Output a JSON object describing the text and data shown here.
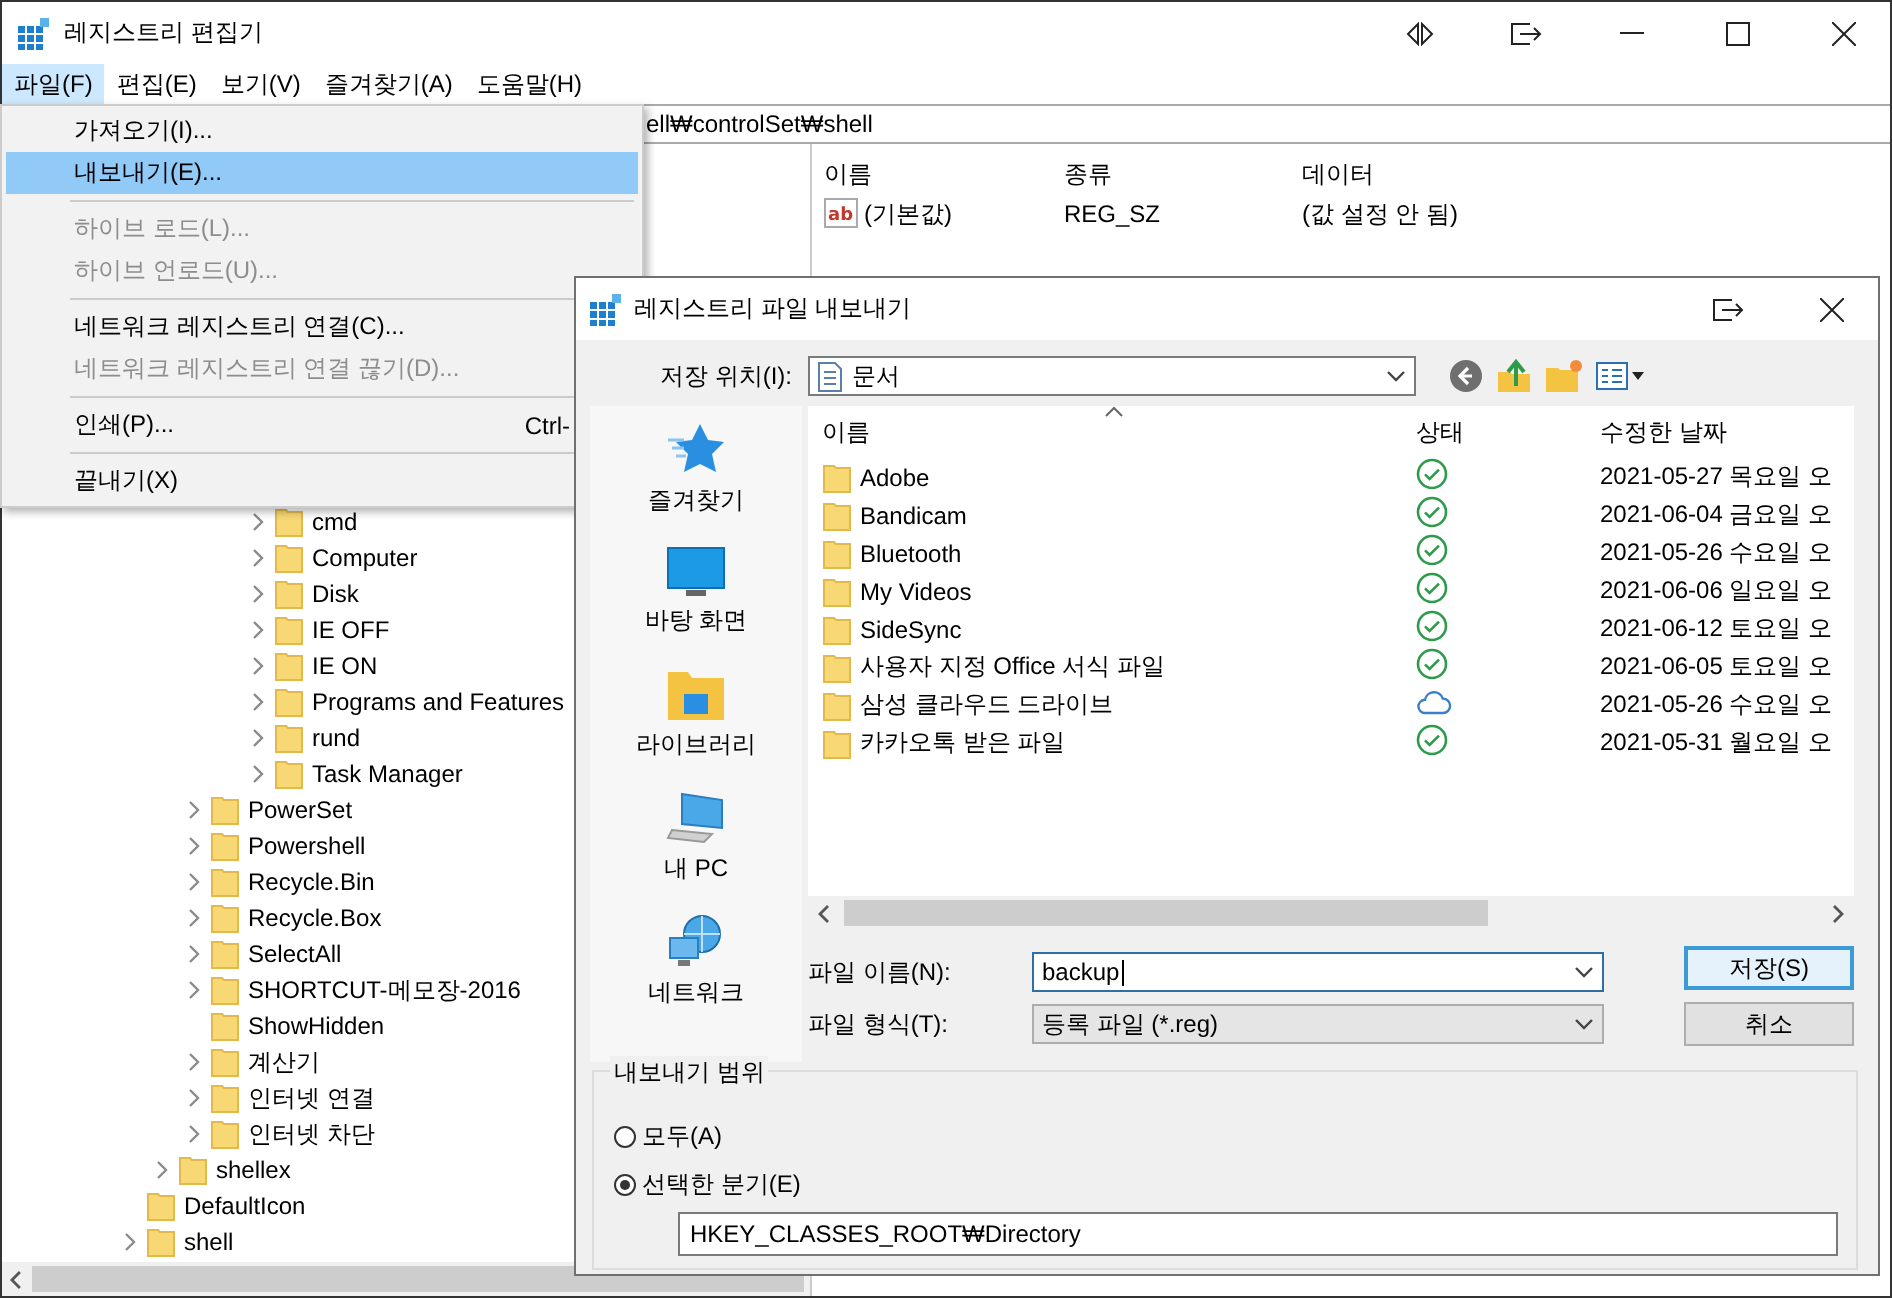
{
  "window": {
    "title": "레지스트리 편집기"
  },
  "menubar": [
    {
      "label": "파일(F)",
      "selected": true
    },
    {
      "label": "편집(E)",
      "selected": false
    },
    {
      "label": "보기(V)",
      "selected": false
    },
    {
      "label": "즐겨찾기(A)",
      "selected": false
    },
    {
      "label": "도움말(H)",
      "selected": false
    }
  ],
  "address": "ell₩controlSet₩shell",
  "tree": [
    {
      "children": [
        {
          "children": [
            {
              "children": [
                {
                  "children": [
                    {
                      "label": "cmd",
                      "expandable": true
                    },
                    {
                      "label": "Computer",
                      "expandable": true
                    },
                    {
                      "label": "Disk",
                      "expandable": true
                    },
                    {
                      "label": "IE OFF",
                      "expandable": true
                    },
                    {
                      "label": "IE ON",
                      "expandable": true
                    },
                    {
                      "label": "Programs and Features",
                      "expandable": true
                    },
                    {
                      "label": "rund",
                      "expandable": true
                    },
                    {
                      "label": "Task Manager",
                      "expandable": true
                    }
                  ]
                }
              ]
            },
            {
              "label": "PowerSet",
              "expandable": true
            },
            {
              "label": "Powershell",
              "expandable": true
            },
            {
              "label": "Recycle.Bin",
              "expandable": true
            },
            {
              "label": "Recycle.Box",
              "expandable": true
            },
            {
              "label": "SelectAll",
              "expandable": true
            },
            {
              "label": "SHORTCUT-메모장-2016",
              "expandable": true
            },
            {
              "label": "ShowHidden",
              "expandable": false
            },
            {
              "label": "계산기",
              "expandable": true
            },
            {
              "label": "인터넷 연결",
              "expandable": true
            },
            {
              "label": "인터넷 차단",
              "expandable": true
            }
          ]
        },
        {
          "label": "shellex",
          "expandable": true
        }
      ]
    },
    {
      "label": "DefaultIcon",
      "expandable": false
    },
    {
      "label": "shell",
      "expandable": true
    }
  ],
  "values": {
    "columns": [
      "이름",
      "종류",
      "데이터"
    ],
    "rows": [
      {
        "icon_text": "ab",
        "name": "(기본값)",
        "type": "REG_SZ",
        "data": "(값 설정 안 됨)"
      }
    ]
  },
  "file_menu": [
    {
      "kind": "item",
      "label": "가져오기(I)...",
      "disabled": false,
      "selected": false
    },
    {
      "kind": "item",
      "label": "내보내기(E)...",
      "disabled": false,
      "selected": true
    },
    {
      "kind": "separator"
    },
    {
      "kind": "item",
      "label": "하이브 로드(L)...",
      "disabled": true,
      "selected": false
    },
    {
      "kind": "item",
      "label": "하이브 언로드(U)...",
      "disabled": true,
      "selected": false
    },
    {
      "kind": "separator"
    },
    {
      "kind": "item",
      "label": "네트워크 레지스트리 연결(C)...",
      "disabled": false,
      "selected": false
    },
    {
      "kind": "item",
      "label": "네트워크 레지스트리 연결 끊기(D)...",
      "disabled": true,
      "selected": false
    },
    {
      "kind": "separator"
    },
    {
      "kind": "item",
      "label": "인쇄(P)...",
      "shortcut": "Ctrl-",
      "disabled": false,
      "selected": false
    },
    {
      "kind": "separator"
    },
    {
      "kind": "item",
      "label": "끝내기(X)",
      "disabled": false,
      "selected": false
    }
  ],
  "dialog": {
    "title": "레지스트리 파일 내보내기",
    "location_label": "저장 위치(I):",
    "location": "문서",
    "places": [
      {
        "kind": "favorites",
        "label": "즐겨찾기"
      },
      {
        "kind": "desktop",
        "label": "바탕 화면"
      },
      {
        "kind": "libraries",
        "label": "라이브러리"
      },
      {
        "kind": "pc",
        "label": "내 PC"
      },
      {
        "kind": "network",
        "label": "네트워크"
      }
    ],
    "columns": [
      "이름",
      "상태",
      "수정한 날짜"
    ],
    "files": [
      {
        "name": "Adobe",
        "kind": "synced",
        "date": "2021-05-27 목요일 오"
      },
      {
        "name": "Bandicam",
        "kind": "synced",
        "date": "2021-06-04 금요일 오"
      },
      {
        "name": "Bluetooth",
        "kind": "synced",
        "date": "2021-05-26 수요일 오"
      },
      {
        "name": "My Videos",
        "kind": "synced",
        "date": "2021-06-06 일요일 오"
      },
      {
        "name": "SideSync",
        "kind": "synced",
        "date": "2021-06-12 토요일 오"
      },
      {
        "name": "사용자 지정 Office 서식 파일",
        "kind": "synced",
        "date": "2021-06-05 토요일 오"
      },
      {
        "name": "삼성 클라우드 드라이브",
        "kind": "online",
        "date": "2021-05-26 수요일 오"
      },
      {
        "name": "카카오톡 받은 파일",
        "kind": "synced",
        "date": "2021-05-31 월요일 오"
      }
    ],
    "filename_label": "파일 이름(N):",
    "filename": "backup",
    "filetype_label": "파일 형식(T):",
    "filetype": "등록 파일 (*.reg)",
    "buttons": [
      {
        "label": "저장(S)",
        "default": true
      },
      {
        "label": "취소",
        "default": false
      }
    ],
    "scope": {
      "title": "내보내기 범위",
      "options": [
        {
          "label": "모두(A)",
          "selected": false
        },
        {
          "label": "선택한 분기(E)",
          "selected": true
        }
      ],
      "branch": "HKEY_CLASSES_ROOT₩Directory"
    }
  }
}
